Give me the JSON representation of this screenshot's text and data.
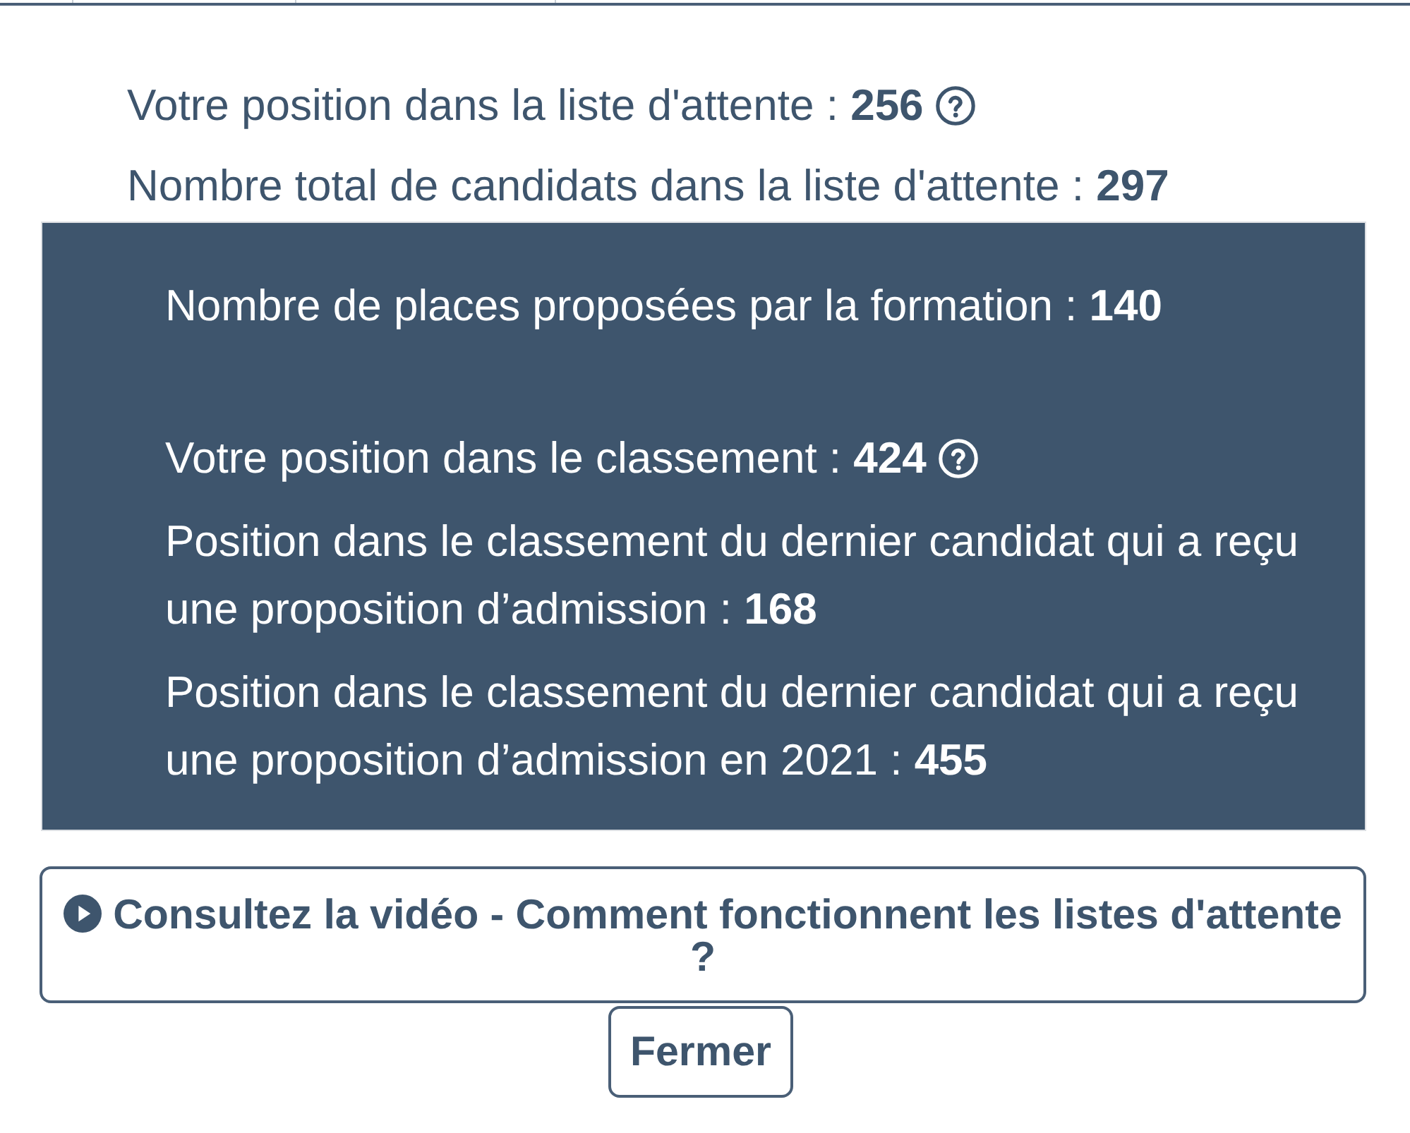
{
  "waitlist": [
    {
      "text": "Votre position dans la liste d'attente : **256**",
      "help_icon": true
    },
    {
      "text": "Nombre total de candidats dans la liste d'attente : **297**",
      "help_icon": false
    }
  ],
  "panel": {
    "sections": [
      {
        "lines": [
          {
            "text": "Nombre de places proposées par la formation : **140**",
            "help_icon": false
          }
        ]
      },
      {
        "lines": [
          {
            "text": "Votre position dans le classement : **424**",
            "help_icon": true
          },
          {
            "text": "Position dans le classement du dernier candidat qui a reçu une proposition d’admission : **168**",
            "help_icon": false
          },
          {
            "text": "Position dans le classement du dernier candidat qui a reçu une proposition d’admission en 2021 : **455**",
            "help_icon": false
          }
        ]
      }
    ]
  },
  "video_button": {
    "label": "Consultez la vidéo - Comment fonctionnent les listes d'attente ?"
  },
  "close_button": {
    "label": "Fermer"
  }
}
